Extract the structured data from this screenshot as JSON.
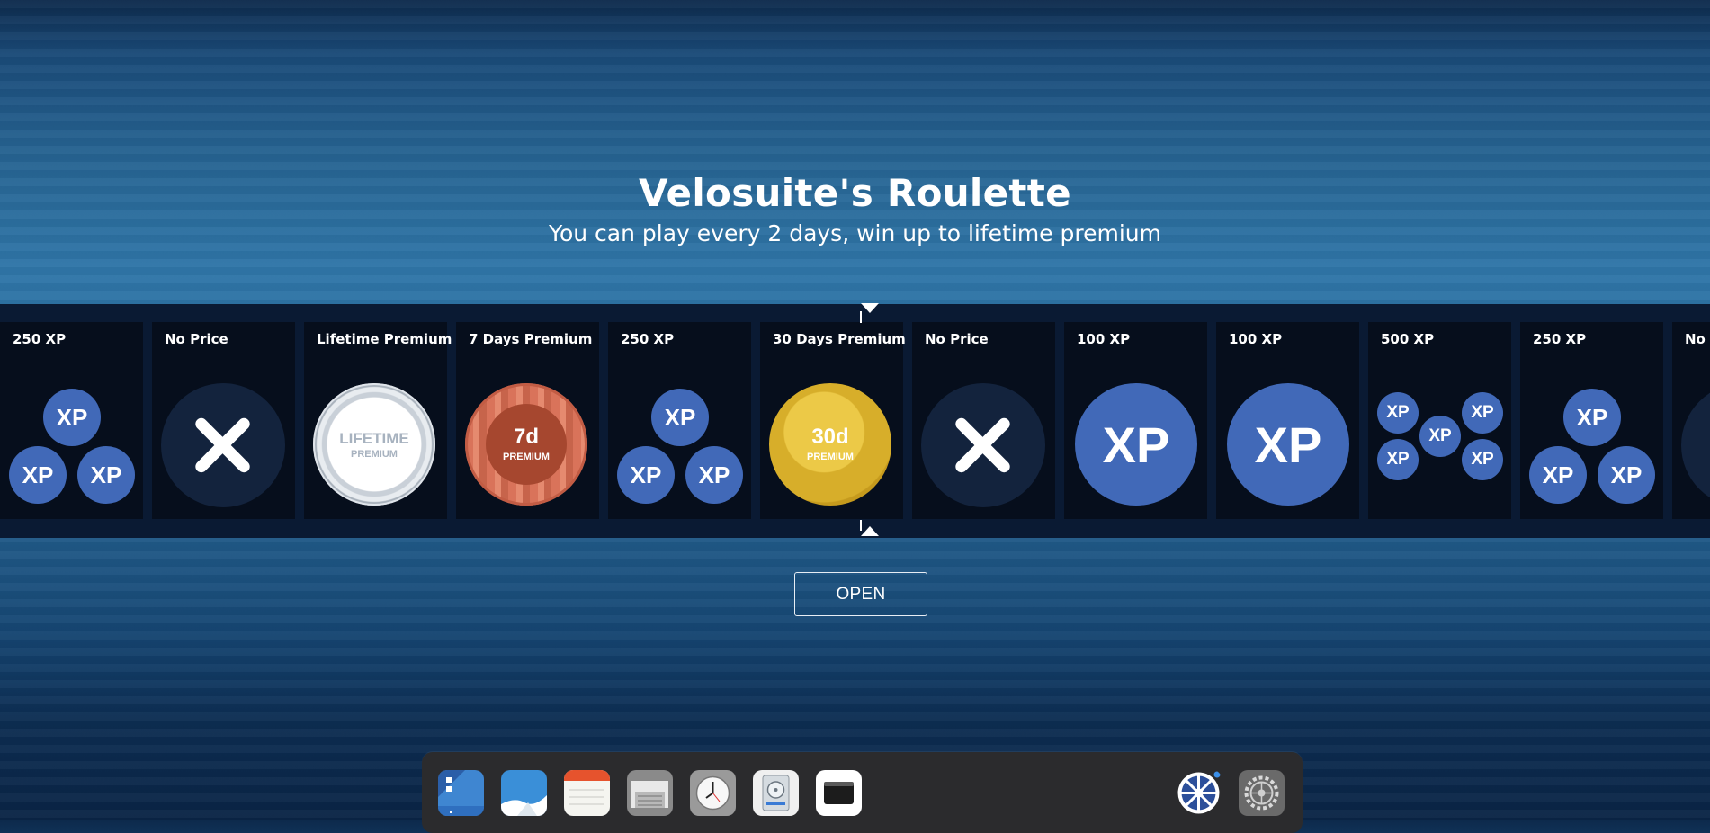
{
  "page": {
    "title": "Velosuite's Roulette",
    "subtitle": "You can play every 2 days, win up to lifetime premium"
  },
  "roulette": {
    "items": [
      {
        "label": "250 XP",
        "prize": "xp-250"
      },
      {
        "label": "No Price",
        "prize": "none"
      },
      {
        "label": "Lifetime Premium",
        "prize": "lifetime",
        "badge_top": "LIFETIME",
        "badge_bottom": "PREMIUM"
      },
      {
        "label": "7 Days Premium",
        "prize": "premium-7d",
        "badge_top": "7d",
        "badge_bottom": "PREMIUM"
      },
      {
        "label": "250 XP",
        "prize": "xp-250"
      },
      {
        "label": "30 Days Premium",
        "prize": "premium-30d",
        "badge_top": "30d",
        "badge_bottom": "PREMIUM"
      },
      {
        "label": "No Price",
        "prize": "none"
      },
      {
        "label": "100 XP",
        "prize": "xp-100"
      },
      {
        "label": "100 XP",
        "prize": "xp-100"
      },
      {
        "label": "500 XP",
        "prize": "xp-500"
      },
      {
        "label": "250 XP",
        "prize": "xp-250"
      },
      {
        "label": "No Price",
        "prize": "none"
      }
    ],
    "xp_token": "XP"
  },
  "controls": {
    "open_label": "OPEN"
  },
  "dock": {
    "apps": [
      {
        "icon": "launcher-icon",
        "color": "#3f86d1"
      },
      {
        "icon": "photos-icon",
        "color": "#3a8fd8"
      },
      {
        "icon": "notes-icon",
        "color": "#f5f5f0"
      },
      {
        "icon": "files-icon",
        "color": "#8a8a8a"
      },
      {
        "icon": "clock-icon",
        "color": "#9a9a9a"
      },
      {
        "icon": "disk-utility-icon",
        "color": "#f0f0f0"
      },
      {
        "icon": "terminal-icon",
        "color": "#ffffff"
      },
      {
        "icon": "roulette-app-icon",
        "color": "#ffffff"
      },
      {
        "icon": "settings-icon",
        "color": "#6a6a6a"
      }
    ]
  },
  "colors": {
    "xp": "#4169b8",
    "band": "#0a1a33",
    "tile": "#060e1c",
    "gold": "#dcb432",
    "copper": "#d9735a"
  }
}
